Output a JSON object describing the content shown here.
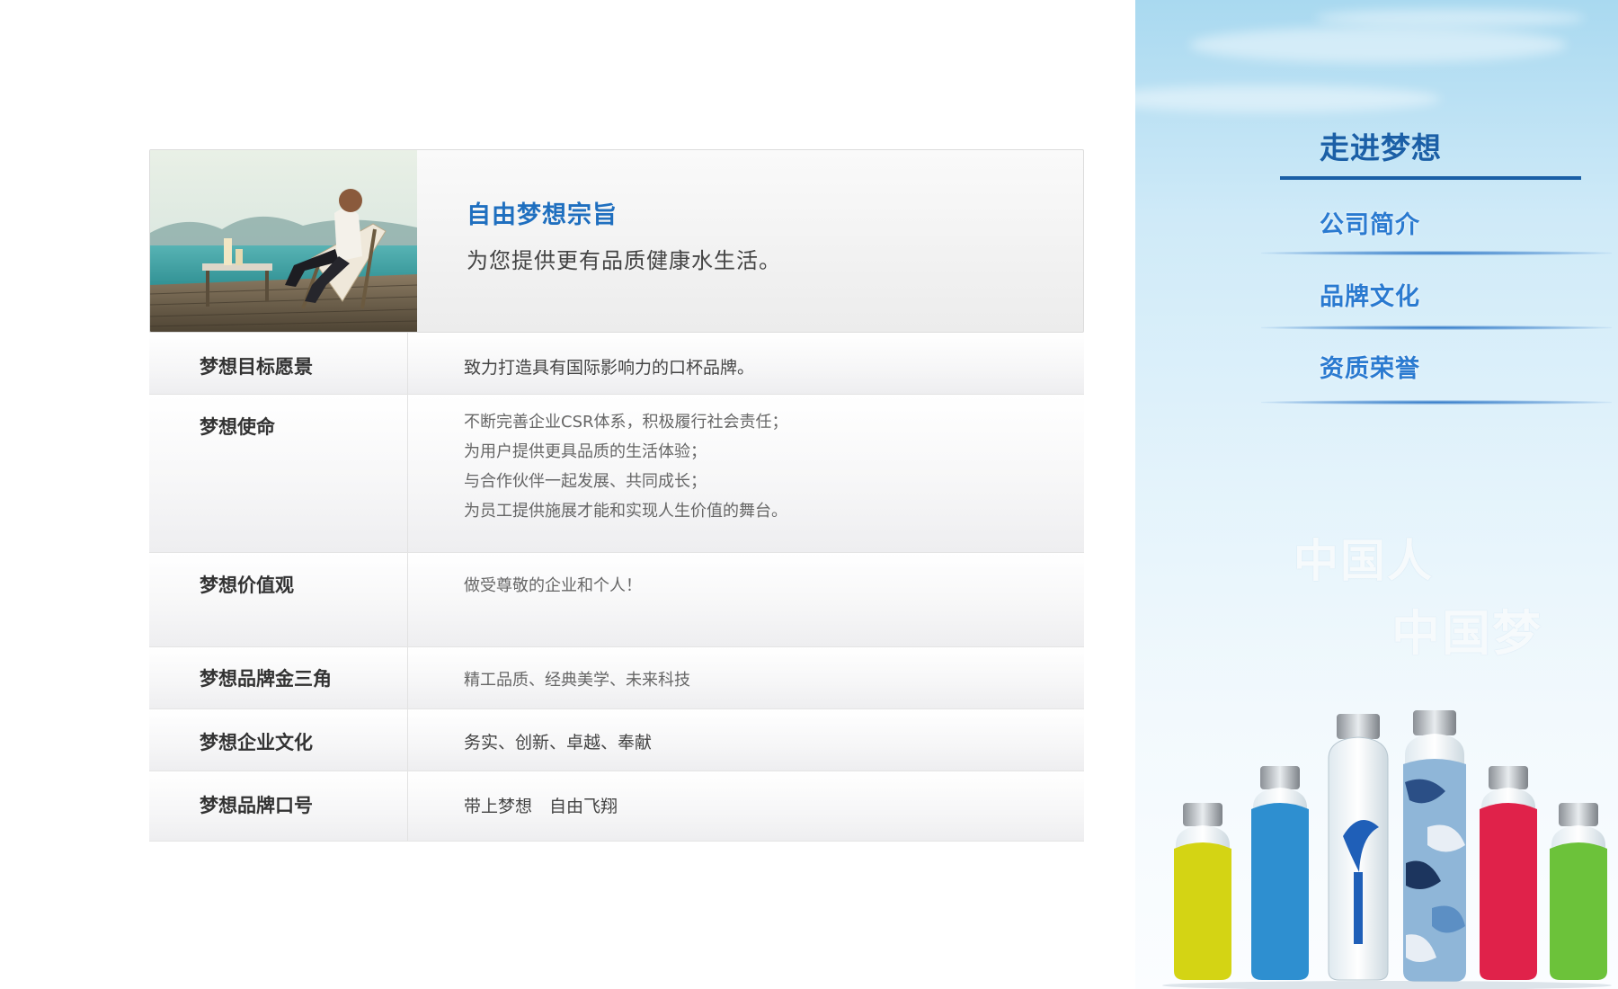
{
  "hero": {
    "title": "自由梦想宗旨",
    "subtitle": "为您提供更有品质健康水生活。"
  },
  "rows": [
    {
      "label": "梦想目标愿景",
      "value": "致力打造具有国际影响力的口杯品牌。"
    },
    {
      "label": "梦想使命",
      "lines": [
        "不断完善企业CSR体系，积极履行社会责任；",
        "为用户提供更具品质的生活体验；",
        "与合作伙伴一起发展、共同成长；",
        "为员工提供施展才能和实现人生价值的舞台。"
      ]
    },
    {
      "label": "梦想价值观",
      "value": "做受尊敬的企业和个人！"
    },
    {
      "label": "梦想品牌金三角",
      "value": "精工品质、经典美学、未来科技"
    },
    {
      "label": "梦想企业文化",
      "value": "务实、创新、卓越、奉献"
    },
    {
      "label": "梦想品牌口号",
      "value": "带上梦想　自由飞翔"
    }
  ],
  "sidebar": {
    "title": "走进梦想",
    "items": [
      {
        "label": "公司简介"
      },
      {
        "label": "品牌文化"
      },
      {
        "label": "资质荣誉"
      }
    ],
    "slogan_line1": "中国人",
    "slogan_line2": "中国梦"
  },
  "colors": {
    "accent": "#1b5fa6",
    "link": "#2a7ad0",
    "bottle_yellow": "#d4d414",
    "bottle_blue": "#2e8fd0",
    "bottle_red": "#e0224a",
    "bottle_green": "#6cc23a"
  }
}
